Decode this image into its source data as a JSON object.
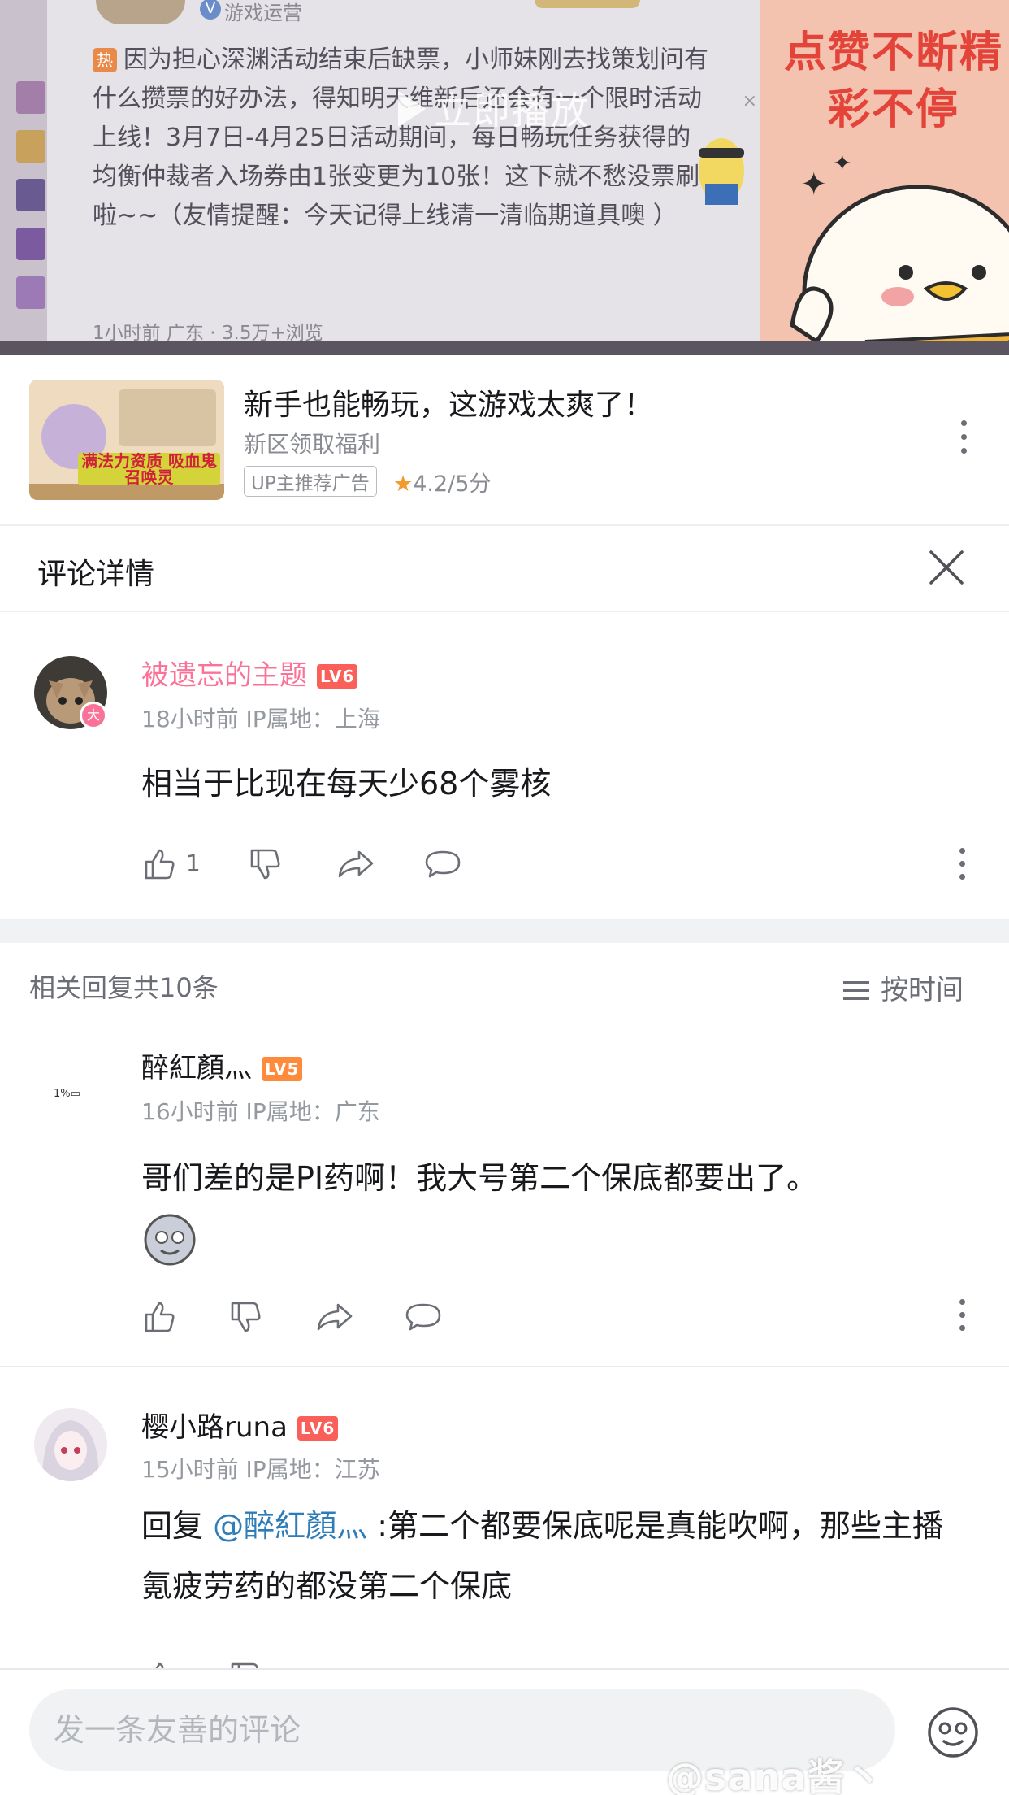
{
  "video": {
    "author": "游戏运营",
    "hot_badge": "热",
    "post_text": "因为担心深渊活动结束后缺票，小师妹刚去找策划问有什么攒票的好办法，得知明天维新后还会有一个限时活动上线！3月7日-4月25日活动期间，每日畅玩任务获得的均衡仲裁者入场券由1张变更为10张！这下就不愁没票刷啦~~（友情提醒：今天记得上线清一清临期道具噢 ）",
    "post_meta": "1小时前  广东 · 3.5万+浏览",
    "play_label": "立即播放",
    "promo_text": "点赞不断精彩不停"
  },
  "ad": {
    "thumb_banner": "满法力资质 吸血鬼召唤灵",
    "title": "新手也能畅玩，这游戏太爽了！",
    "subtitle": "新区领取福利",
    "tag": "UP主推荐广告",
    "rating": "4.2/5分",
    "star_color": "#f39a2e"
  },
  "detail": {
    "title": "评论详情"
  },
  "main_comment": {
    "username": "被遗忘的主题",
    "level": "LV6",
    "username_color": "#fb7299",
    "time": "18小时前",
    "ip": "IP属地：上海",
    "text": "相当于比现在每天少68个雾核",
    "likes": "1"
  },
  "replies_header": {
    "count_label": "相关回复共10条",
    "sort_label": "按时间"
  },
  "replies": [
    {
      "username": "醉紅顏灬",
      "level": "LV5",
      "avatar_text": "1%▭",
      "time": "16小时前",
      "ip": "IP属地：广东",
      "text": "哥们差的是PI药啊！我大号第二个保底都要出了。"
    },
    {
      "username": "樱小路runa",
      "level": "LV6",
      "time": "15小时前",
      "ip": "IP属地：江苏",
      "reply_prefix": "回复 ",
      "mention": "@醉紅顏灬",
      "text": " :第二个都要保底呢是真能吹啊，那些主播氪疲劳药的都没第二个保底"
    }
  ],
  "input": {
    "placeholder": "发一条友善的评论"
  },
  "watermark": "@sana酱丶",
  "colors": {
    "lv6": "#fb5f5a",
    "lv5": "#ff8a3b",
    "mention": "#2f7db8"
  }
}
